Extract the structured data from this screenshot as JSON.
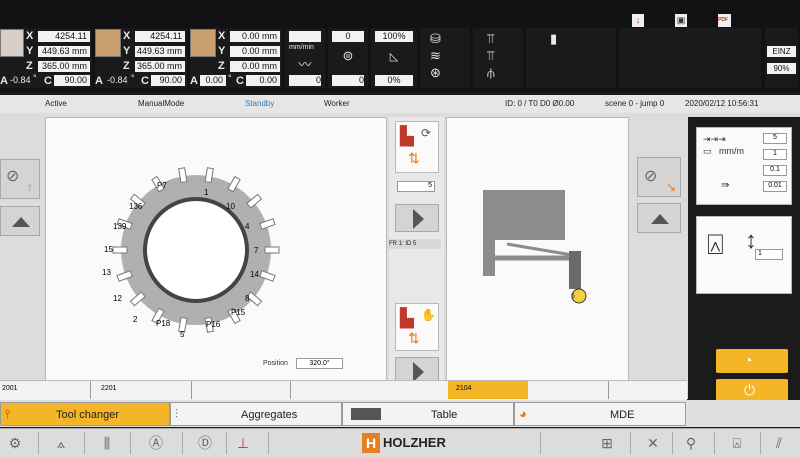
{
  "top": {
    "blocks": [
      {
        "x": "4254.11 mm",
        "y": "449.63 mm",
        "z": "365.00 mm",
        "a_label": "-0.84",
        "c_label": "90.00"
      },
      {
        "x": "4254.11 mm",
        "y": "449.63 mm",
        "z": "365.00 mm",
        "a_label": "-0.84",
        "c_label": "90.00"
      },
      {
        "x": "0.00 mm",
        "y": "0.00 mm",
        "z": "0.00 mm",
        "a_label": "0.00",
        "c_label": "0.00"
      }
    ],
    "axis_x": "X",
    "axis_y": "Y",
    "axis_z": "Z",
    "axis_a": "A",
    "axis_c": "C",
    "degree": "°",
    "feed_unit": "mm/min",
    "feed_value": "0",
    "spindle_top": "0",
    "spindle_bottom": "0",
    "override_top": "100%",
    "override_bottom": "0%",
    "einz": "EINZ",
    "einz_pct": "90%",
    "pdf_label": "PDF"
  },
  "status": {
    "active": "Active",
    "mode": "ManualMode",
    "standby": "Standby",
    "worker": "Worker",
    "id": "ID: 0 / T0 D0 Ø0.00",
    "scene": "scene 0 - jump 0",
    "datetime": "2020/02/12 10:56:31"
  },
  "changer": {
    "labels": [
      "P7",
      "1",
      "10",
      "4",
      "7",
      "14",
      "8",
      "P15",
      "P16",
      "5",
      "P18",
      "2",
      "12",
      "13",
      "15",
      "139",
      "136"
    ],
    "position_label": "Position",
    "position_value": "320.0°"
  },
  "mid": {
    "field_value": "5",
    "fr_label": "FR 1: ID 5"
  },
  "aggregate": {
    "tool_number": "6"
  },
  "right": {
    "step_values": [
      "5",
      "1",
      "0.1",
      "0.01"
    ],
    "unit": "mm/m",
    "select_value": "1"
  },
  "footer_ids": [
    "2001",
    "2201",
    "2104"
  ],
  "tabs": [
    "Tool changer",
    "Aggregates",
    "Table",
    "MDE"
  ],
  "brand": "HOLZHER",
  "colors": {
    "accent": "#f4b526",
    "active_tab": "#f4b526",
    "standby": "#2a7fbf"
  }
}
